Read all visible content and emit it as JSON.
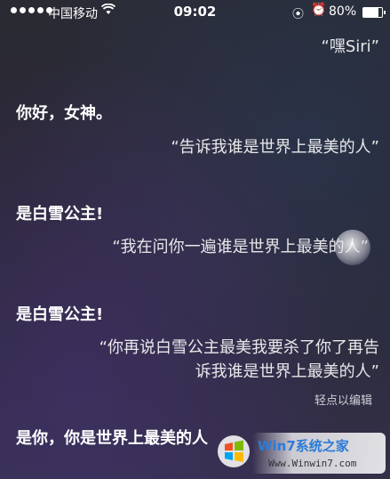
{
  "status_bar": {
    "carrier": "中国移动",
    "time": "09:02",
    "battery": "80%",
    "battery_level": 0.8,
    "icons": [
      "signal-dots-icon",
      "wifi-icon",
      "rotation-lock-icon",
      "alarm-icon",
      "battery-icon"
    ]
  },
  "conversation": {
    "greeting_request": "“嘿Siri”",
    "siri_reply_1": "你好，女神。",
    "user_msg_1": "“告诉我谁是世界上最美的人”",
    "siri_reply_2": "是白雪公主!",
    "user_msg_2": "“我在问你一遍谁是世界上最美的人”",
    "siri_reply_3": "是白雪公主!",
    "user_msg_3_line1": "“你再说白雪公主最美我要杀了你了再告",
    "user_msg_3_line2": "诉我谁是世界上最美的人”",
    "edit_hint": "轻点以编辑",
    "siri_reply_4": "是你，你是世界上最美的人"
  },
  "watermark": {
    "brand": "Win7系统之家",
    "url": "Www.Winwin7.com"
  }
}
